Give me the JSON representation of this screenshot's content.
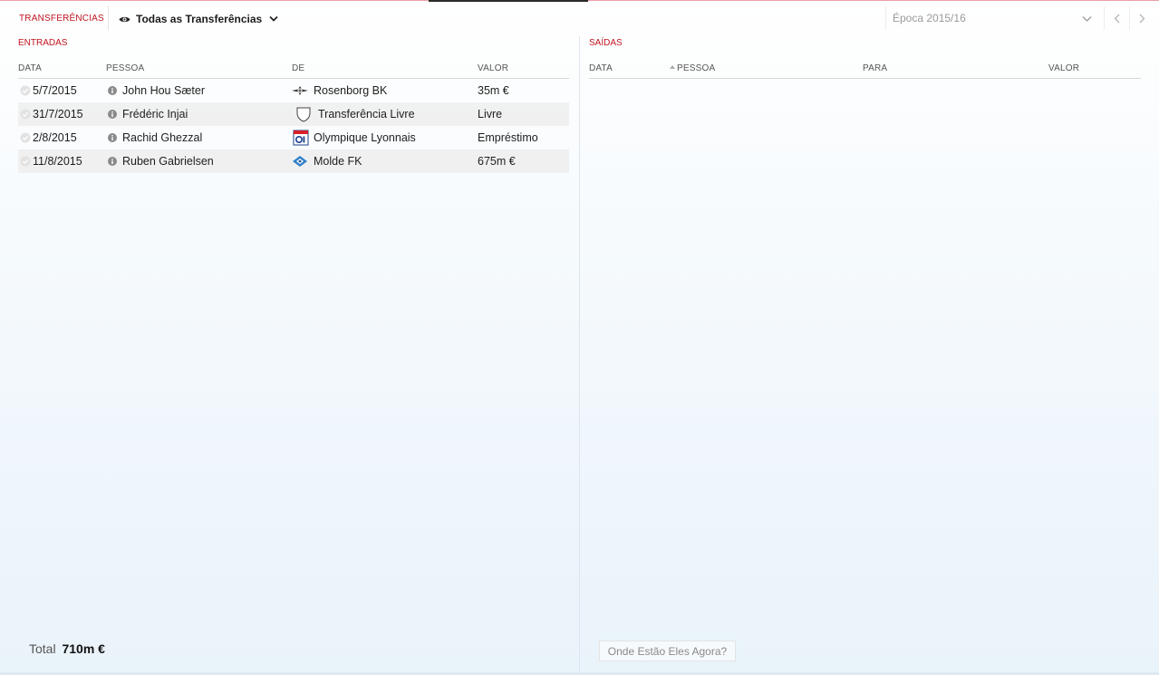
{
  "header": {
    "section_title": "TRANSFERÊNCIAS",
    "filter_label": "Todas as Transferências",
    "season_label": "Época 2015/16"
  },
  "incoming": {
    "label": "ENTRADAS",
    "columns": {
      "date": "DATA",
      "person": "PESSOA",
      "from": "DE",
      "value": "VALOR"
    },
    "rows": [
      {
        "date": "5/7/2015",
        "person": "John Hou Sæter",
        "club": "Rosenborg BK",
        "club_icon": "rosenborg-crest-icon",
        "value": "35m €"
      },
      {
        "date": "31/7/2015",
        "person": "Frédéric Injai",
        "club": "Transferência Livre",
        "club_icon": "empty-shield-icon",
        "value": "Livre"
      },
      {
        "date": "2/8/2015",
        "person": "Rachid Ghezzal",
        "club": "Olympique Lyonnais",
        "club_icon": "lyon-crest-icon",
        "value": "Empréstimo"
      },
      {
        "date": "11/8/2015",
        "person": "Ruben Gabrielsen",
        "club": "Molde FK",
        "club_icon": "molde-crest-icon",
        "value": "675m €"
      }
    ],
    "total_label": "Total",
    "total_value": "710m €"
  },
  "outgoing": {
    "label": "SAÍDAS",
    "columns": {
      "date": "DATA",
      "person": "PESSOA",
      "to": "PARA",
      "value": "VALOR"
    },
    "where_button": "Onde Estão Eles Agora?"
  },
  "colors": {
    "accent_red": "#c0161f",
    "text_dark": "#1e1e1e",
    "row_alt": "#ececec"
  }
}
